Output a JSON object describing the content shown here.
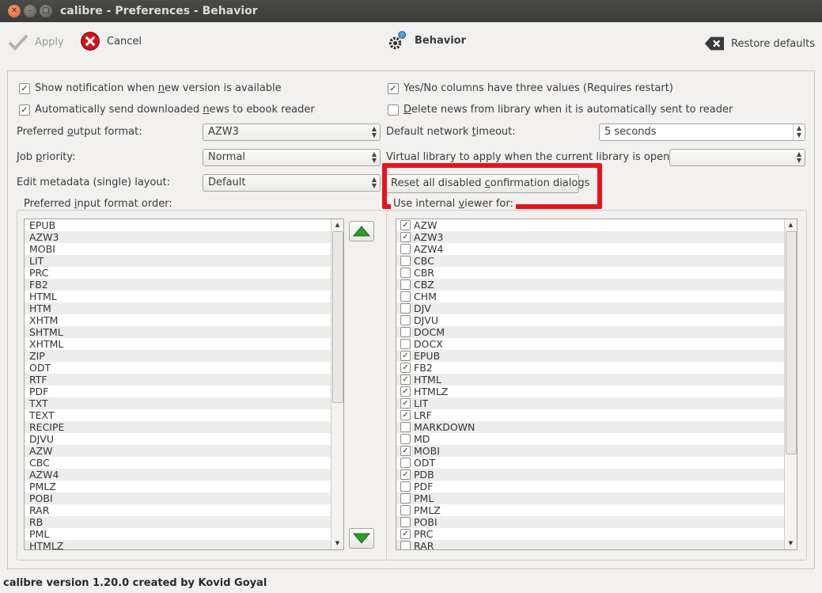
{
  "window": {
    "title": "calibre - Preferences - Behavior"
  },
  "toolbar": {
    "apply_label": "Apply",
    "cancel_label": "Cancel",
    "section_label": "Behavior",
    "restore_label": "Restore defaults"
  },
  "options": {
    "show_notification": {
      "pre": "Show notification when ",
      "ul": "n",
      "post": "ew version is available",
      "checked": true
    },
    "auto_send_news": {
      "pre": "Automatically send downloaded ",
      "ul": "n",
      "post": "ews to ebook reader",
      "checked": true
    },
    "yes_no_columns": {
      "pre": "Yes/No columns have three values (Requires restart)",
      "ul": "",
      "post": "",
      "checked": true
    },
    "delete_news": {
      "pre": "",
      "ul": "D",
      "post": "elete news from library when it is automatically sent to reader",
      "checked": false
    }
  },
  "fields": {
    "output_format": {
      "label_pre": "Preferred ",
      "label_ul": "o",
      "label_post": "utput format:",
      "value": "AZW3"
    },
    "job_priority": {
      "label_pre": "Job ",
      "label_ul": "p",
      "label_post": "riority:",
      "value": "Normal"
    },
    "edit_metadata": {
      "label_pre": "Edit metadata (single) layout:",
      "label_ul": "",
      "label_post": "",
      "value": "Default"
    },
    "network_timeout": {
      "label_pre": "Default network ",
      "label_ul": "t",
      "label_post": "imeout:",
      "value": "5 seconds"
    },
    "virtual_library": {
      "label_pre": "Virtual library to apply when the current library is opened:",
      "label_ul": "",
      "label_post": "",
      "value": ""
    }
  },
  "reset_button": {
    "pre": "Reset all disabled ",
    "ul": "c",
    "post": "onfirmation dialogs"
  },
  "input_order": {
    "title_pre": "Preferred ",
    "title_ul": "i",
    "title_post": "nput format order:",
    "items": [
      "EPUB",
      "AZW3",
      "MOBI",
      "LIT",
      "PRC",
      "FB2",
      "HTML",
      "HTM",
      "XHTM",
      "SHTML",
      "XHTML",
      "ZIP",
      "ODT",
      "RTF",
      "PDF",
      "TXT",
      "TEXT",
      "RECIPE",
      "DJVU",
      "AZW",
      "CBC",
      "AZW4",
      "PMLZ",
      "POBI",
      "RAR",
      "RB",
      "PML",
      "HTMLZ"
    ]
  },
  "internal_viewer": {
    "title_pre": "Use internal ",
    "title_ul": "v",
    "title_post": "iewer for:",
    "items": [
      {
        "label": "AZW",
        "checked": true
      },
      {
        "label": "AZW3",
        "checked": true
      },
      {
        "label": "AZW4",
        "checked": false
      },
      {
        "label": "CBC",
        "checked": false
      },
      {
        "label": "CBR",
        "checked": false
      },
      {
        "label": "CBZ",
        "checked": false
      },
      {
        "label": "CHM",
        "checked": false
      },
      {
        "label": "DJV",
        "checked": false
      },
      {
        "label": "DJVU",
        "checked": false
      },
      {
        "label": "DOCM",
        "checked": false
      },
      {
        "label": "DOCX",
        "checked": false
      },
      {
        "label": "EPUB",
        "checked": true
      },
      {
        "label": "FB2",
        "checked": true
      },
      {
        "label": "HTML",
        "checked": true
      },
      {
        "label": "HTMLZ",
        "checked": true
      },
      {
        "label": "LIT",
        "checked": true
      },
      {
        "label": "LRF",
        "checked": true
      },
      {
        "label": "MARKDOWN",
        "checked": false
      },
      {
        "label": "MD",
        "checked": false
      },
      {
        "label": "MOBI",
        "checked": true
      },
      {
        "label": "ODT",
        "checked": false
      },
      {
        "label": "PDB",
        "checked": true
      },
      {
        "label": "PDF",
        "checked": false
      },
      {
        "label": "PML",
        "checked": false
      },
      {
        "label": "PMLZ",
        "checked": false
      },
      {
        "label": "POBI",
        "checked": false
      },
      {
        "label": "PRC",
        "checked": true
      },
      {
        "label": "RAR",
        "checked": false
      }
    ]
  },
  "status": {
    "text": "calibre version 1.20.0 created by Kovid Goyal"
  },
  "icons": {
    "apply": "checkmark-icon",
    "cancel": "cancel-icon",
    "section": "gear-icon",
    "restore": "backspace-icon",
    "up": "arrow-up-icon",
    "down": "arrow-down-icon"
  },
  "colors": {
    "highlight": "#e8141b",
    "cancel_red": "#d0121b",
    "arrow_green": "#2e9b2b"
  }
}
